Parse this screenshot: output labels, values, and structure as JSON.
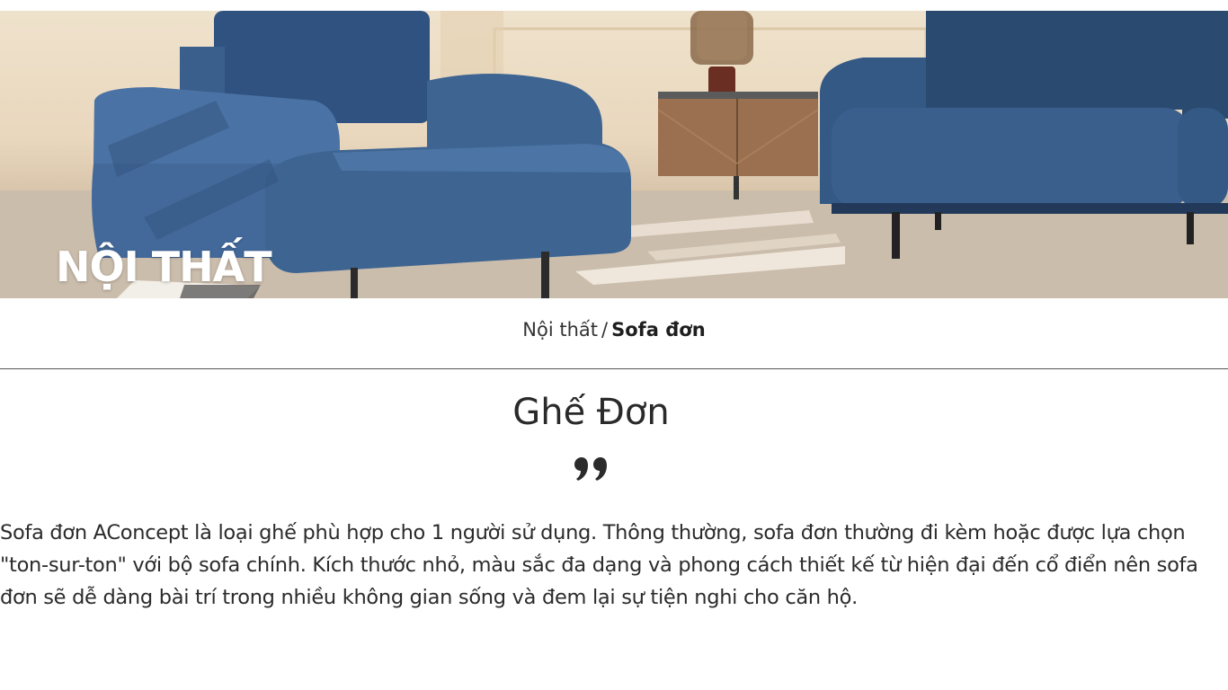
{
  "hero": {
    "title": "NỘI THẤT"
  },
  "breadcrumb": {
    "parent_label": "Nội thất",
    "separator": "/",
    "current_label": "Sofa đơn"
  },
  "content": {
    "heading": "Ghế Đơn",
    "quote_icon": "quote-icon",
    "description": "Sofa đơn AConcept là loại ghế phù hợp cho 1 người sử dụng. Thông thường, sofa đơn thường đi kèm hoặc được lựa chọn \"ton-sur-ton\" với bộ sofa chính. Kích thước nhỏ, màu sắc đa dạng và phong cách thiết kế từ hiện đại đến cổ điển nên sofa đơn sẽ dễ dàng bài trí trong nhiều không gian sống và đem lại sự tiện nghi cho căn hộ."
  },
  "colors": {
    "sofa_blue": "#3a5f8c",
    "sofa_blue_dark": "#2b4a70",
    "wall": "#ecdcc4",
    "floor": "#cdbfae",
    "cabinet_wood": "#9a7050",
    "text": "#2b2b2b"
  }
}
